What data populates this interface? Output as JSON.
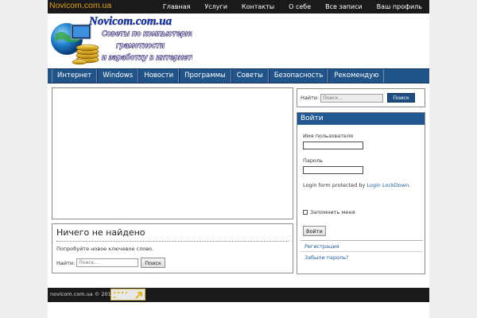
{
  "topbar": {
    "site_title": "Novicom.com.ua",
    "nav": [
      "Главная",
      "Услуги",
      "Контакты",
      "О себе",
      "Все записи",
      "Ваш профиль"
    ]
  },
  "header": {
    "logo_title": "Novicom.com.ua",
    "logo_lines": [
      "Советы по компьютерной",
      "грамотности",
      "и заработку в интернете"
    ]
  },
  "mainnav": {
    "items": [
      "Интернет",
      "Windows",
      "Новости",
      "Программы",
      "Советы",
      "Безопасность",
      "Рекомендую"
    ]
  },
  "notfound": {
    "title": "Ничего не найдено",
    "message": "Попробуйте новое ключевое слово.",
    "search_label": "Найти:",
    "search_placeholder": "Поиск...",
    "search_button": "Поиск"
  },
  "sidebar": {
    "search_label": "Найти:",
    "search_placeholder": "Поиск...",
    "search_button": "Поиск",
    "login": {
      "title": "Войти",
      "username_label": "Имя пользователя",
      "password_label": "Пароль",
      "protected_text": "Login form protected by ",
      "lockdown_link": "Login LockDown",
      "lockdown_after": ".",
      "remember_label": "Запомнить меня",
      "login_button": "Войти",
      "links": [
        "Регистрация",
        "Забыли пароль?"
      ]
    }
  },
  "footer": {
    "copyright": "novicom.com.ua © 2014"
  },
  "colors": {
    "accent": "#e2a11c",
    "nav_blue": "#215488",
    "dark_bar": "#1a1a1a"
  }
}
